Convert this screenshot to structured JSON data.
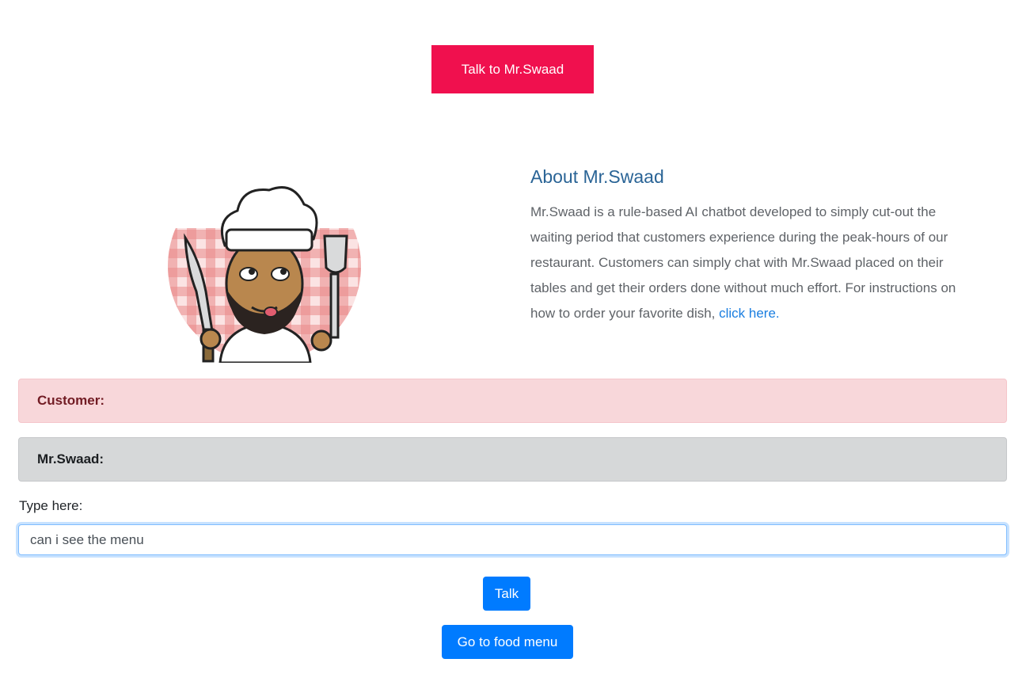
{
  "header": {
    "talk_button_label": "Talk to Mr.Swaad"
  },
  "about": {
    "title": "About Mr.Swaad",
    "body": "Mr.Swaad is a rule-based AI chatbot developed to simply cut-out the waiting period that customers experience during the peak-hours of our restaurant. Customers can simply chat with Mr.Swaad placed on their tables and get their orders done without much effort. For instructions on how to order your favorite dish, ",
    "link_label": "click here."
  },
  "chat": {
    "customer_label": "Customer:",
    "bot_label": "Mr.Swaad:",
    "input_label": "Type here:",
    "input_value": "can i see the menu"
  },
  "actions": {
    "talk_label": "Talk",
    "food_menu_label": "Go to food menu"
  },
  "colors": {
    "hero_button": "#f0104e",
    "primary": "#007bff",
    "customer_bg": "#f8d7da",
    "bot_bg": "#d6d8d9",
    "heading": "#2a6496"
  },
  "icons": {
    "avatar": "chef-avatar-icon"
  }
}
